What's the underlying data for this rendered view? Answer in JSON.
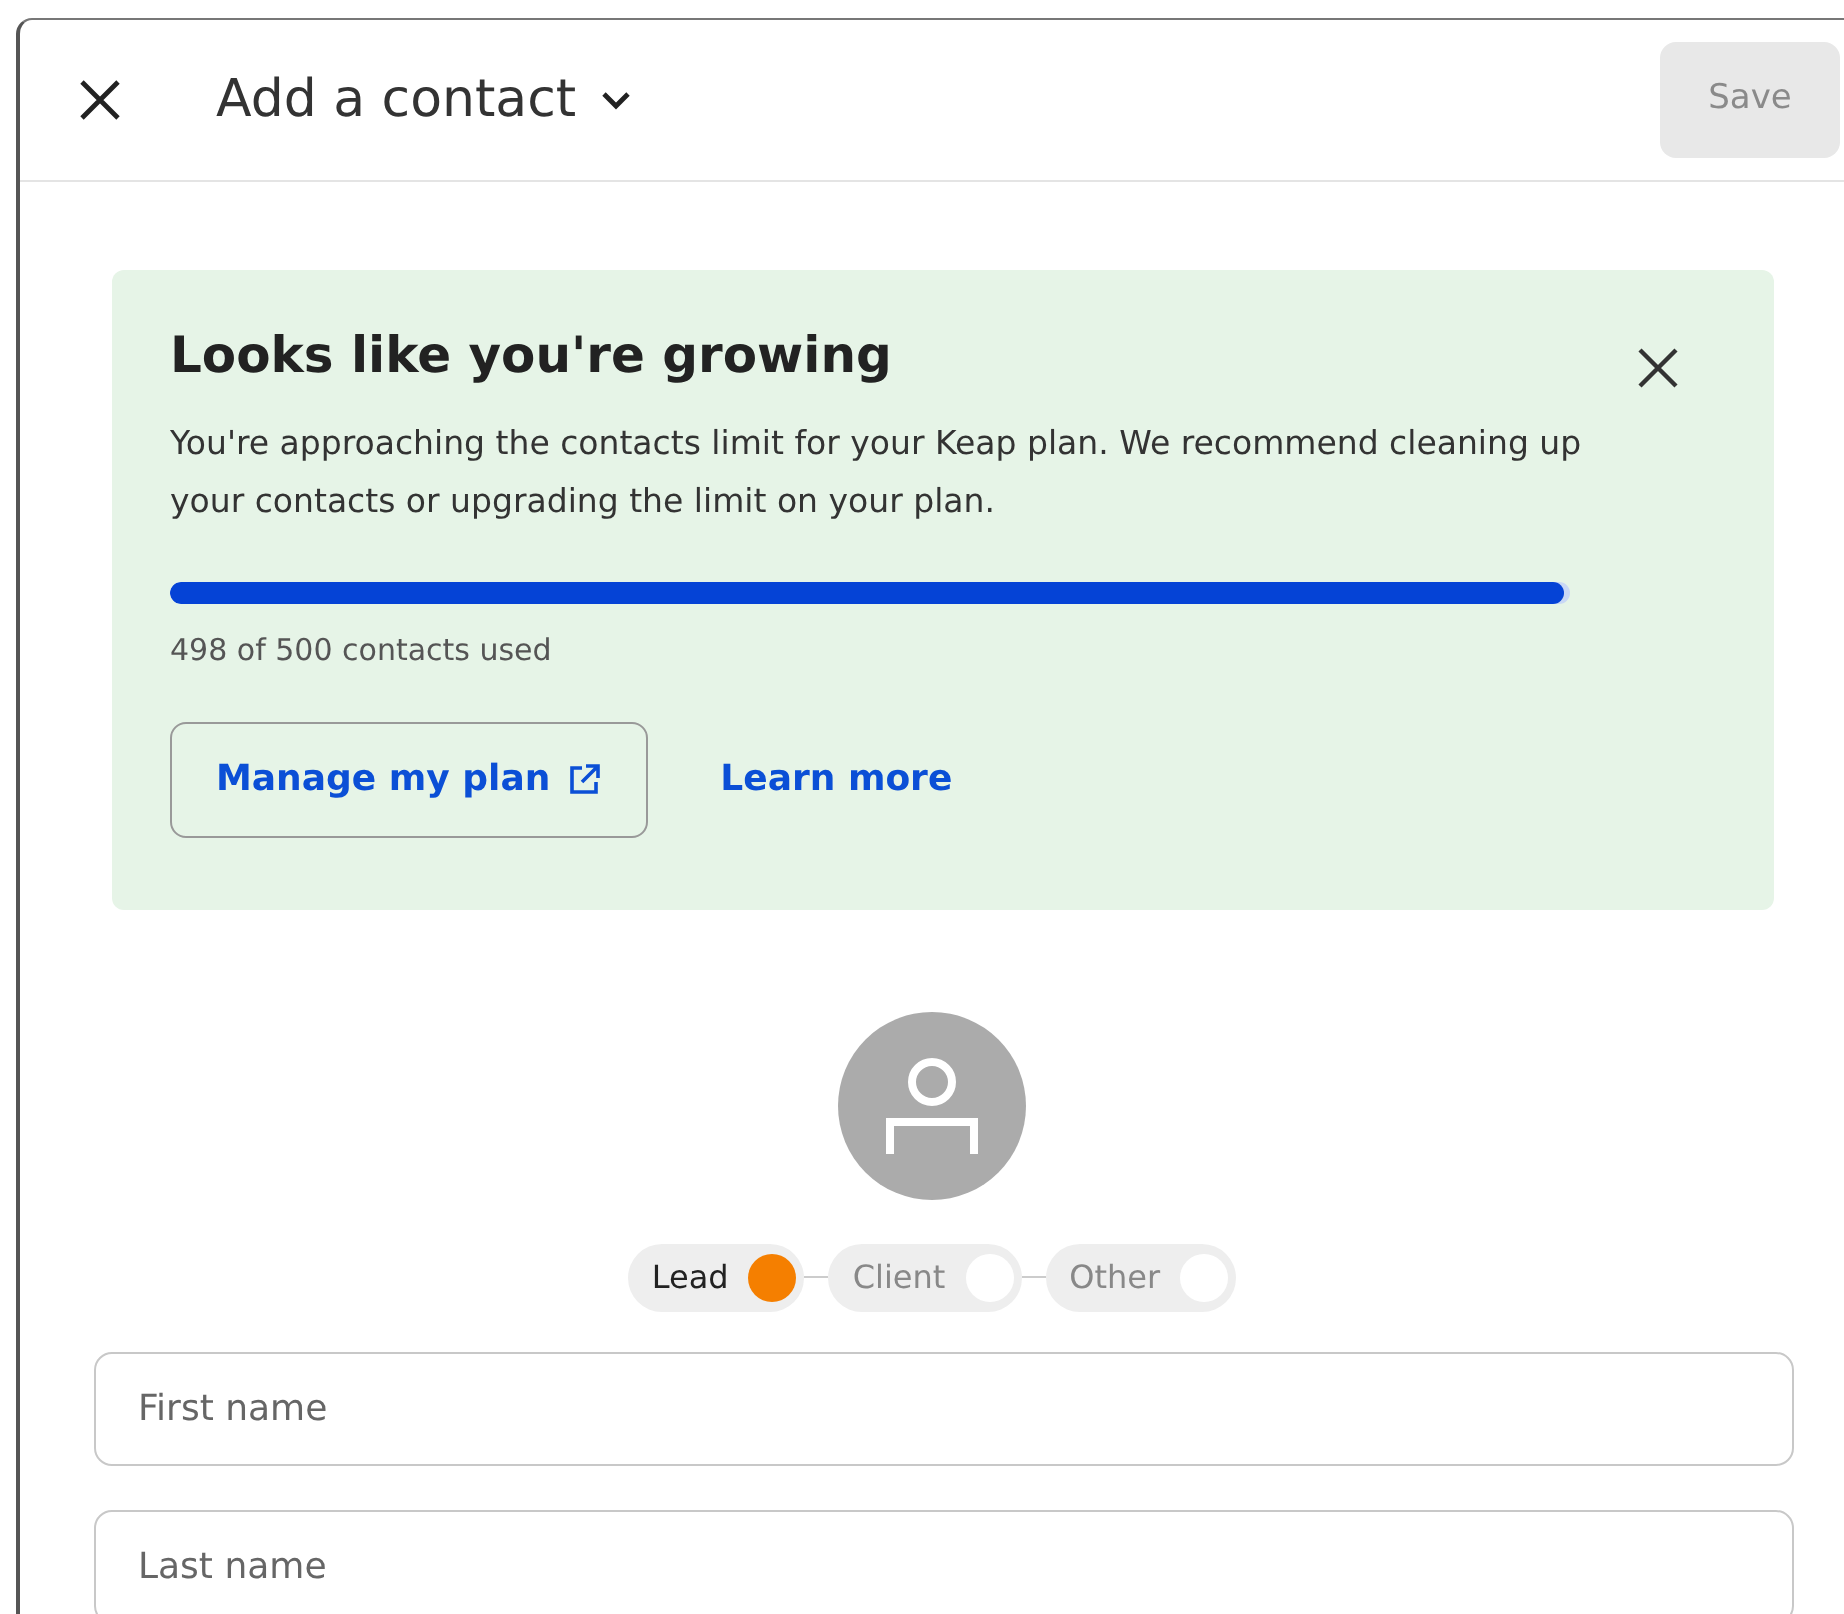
{
  "header": {
    "title": "Add a contact",
    "save": {
      "label": "Save",
      "disabled": true
    }
  },
  "banner": {
    "title": "Looks like you're growing",
    "text": "You're approaching the contacts limit for your Keap plan. We recommend cleaning up your contacts or upgrading the limit on your plan.",
    "usage": {
      "level": 0.996,
      "reading": "498 of 500 contacts used"
    },
    "actions": [
      {
        "label": "Manage my plan",
        "kind": "outline"
      },
      {
        "label": "Learn more",
        "kind": "link"
      }
    ]
  },
  "stages": [
    {
      "label": "Lead",
      "selected": true
    },
    {
      "label": "Client",
      "selected": false
    },
    {
      "label": "Other",
      "selected": false
    }
  ],
  "fields": [
    {
      "placeholder": "First name"
    },
    {
      "placeholder": "Last name"
    }
  ]
}
